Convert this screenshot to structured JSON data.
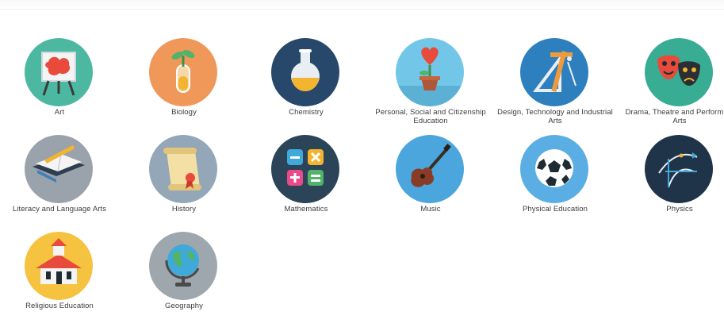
{
  "subjects": [
    {
      "label": "Art",
      "icon": "art-easel-icon",
      "color": "#4db8a1"
    },
    {
      "label": "Biology",
      "icon": "plant-test-tube-icon",
      "color": "#f0975a"
    },
    {
      "label": "Chemistry",
      "icon": "flask-icon",
      "color": "#27486b"
    },
    {
      "label": "Personal, Social and Citizenship Education",
      "icon": "potted-heart-icon",
      "color": "#72c7e8"
    },
    {
      "label": "Design, Technology and Industrial Arts",
      "icon": "drafting-tools-icon",
      "color": "#2e7fbe"
    },
    {
      "label": "Drama, Theatre and Performing Arts",
      "icon": "theatre-masks-icon",
      "color": "#38ad94"
    },
    {
      "label": "Literacy and Language Arts",
      "icon": "book-pencil-icon",
      "color": "#9aa2ab"
    },
    {
      "label": "History",
      "icon": "scroll-icon",
      "color": "#93a7b8"
    },
    {
      "label": "Mathematics",
      "icon": "calculator-icon",
      "color": "#2b4457"
    },
    {
      "label": "Music",
      "icon": "guitar-icon",
      "color": "#4aa6dd"
    },
    {
      "label": "Physical Education",
      "icon": "soccer-ball-icon",
      "color": "#5aaee3"
    },
    {
      "label": "Physics",
      "icon": "trajectory-icon",
      "color": "#1f3448"
    },
    {
      "label": "Religious Education",
      "icon": "temple-icon",
      "color": "#f6c340"
    },
    {
      "label": "Geography",
      "icon": "globe-icon",
      "color": "#9ea7ad"
    }
  ]
}
